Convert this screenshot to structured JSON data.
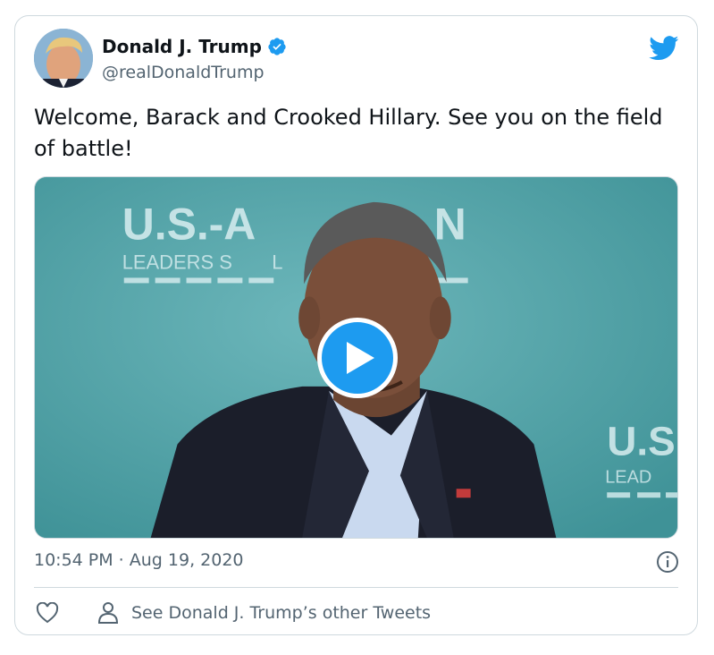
{
  "tweet": {
    "author_name": "Donald J. Trump",
    "handle": "@realDonaldTrump",
    "text": "Welcome, Barack and Crooked Hillary. See you on the field of battle!",
    "timestamp": "10:54 PM · Aug 19, 2020",
    "other_tweets_label": "See Donald J. Trump’s other Tweets"
  },
  "media": {
    "backdrop_text_1": "U.S.-A",
    "backdrop_text_1b": "N",
    "backdrop_text_2": "LEADERS S",
    "backdrop_text_2b": "L",
    "backdrop_text_3": "U.S",
    "backdrop_text_4": "LEAD"
  },
  "icons": {
    "verified": "verified-badge-icon",
    "brand": "twitter-bird-icon",
    "info": "info-icon",
    "like": "heart-icon",
    "profile": "person-icon",
    "play": "play-icon"
  },
  "colors": {
    "accent": "#1d9bf0",
    "text": "#0f1419",
    "secondary": "#536471",
    "border": "#cfd9de",
    "video_bg": "#4fa1a6"
  }
}
